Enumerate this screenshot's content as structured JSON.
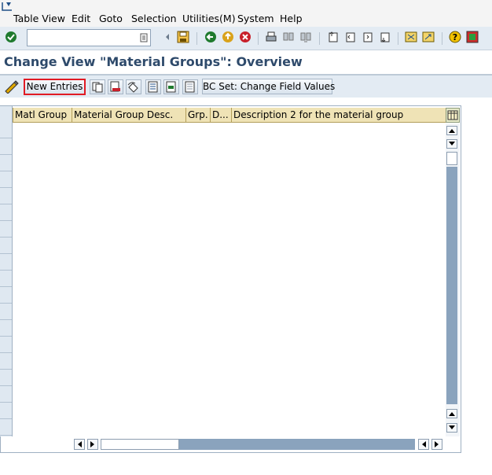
{
  "menu": {
    "items": [
      {
        "label": "Table View"
      },
      {
        "label": "Edit"
      },
      {
        "label": "Goto"
      },
      {
        "label": "Selection"
      },
      {
        "label": "Utilities(M)"
      },
      {
        "label": "System"
      },
      {
        "label": "Help"
      }
    ]
  },
  "toolbar": {
    "command_value": "",
    "icons": [
      "enter-check-icon",
      "save-icon",
      "back-icon",
      "exit-icon",
      "cancel-icon",
      "print-icon",
      "find-icon",
      "find-next-icon",
      "first-page-icon",
      "previous-page-icon",
      "next-page-icon",
      "last-page-icon",
      "create-session-icon",
      "shortcut-icon",
      "help-icon",
      "customize-layout-icon"
    ]
  },
  "title": "Change View \"Material Groups\": Overview",
  "app_toolbar": {
    "new_entries": "New Entries",
    "bc_set": "BC Set: Change Field Values"
  },
  "table": {
    "columns": [
      {
        "label": "Matl Group"
      },
      {
        "label": "Material Group Desc."
      },
      {
        "label": "Grp."
      },
      {
        "label": "D..."
      },
      {
        "label": "Description 2 for the material group"
      }
    ],
    "rows": []
  },
  "colors": {
    "title": "#2e4a6b",
    "toolbar_bg": "#e3ebf3",
    "table_header_bg": "#efe3b6",
    "highlight_border": "#e11b24"
  }
}
